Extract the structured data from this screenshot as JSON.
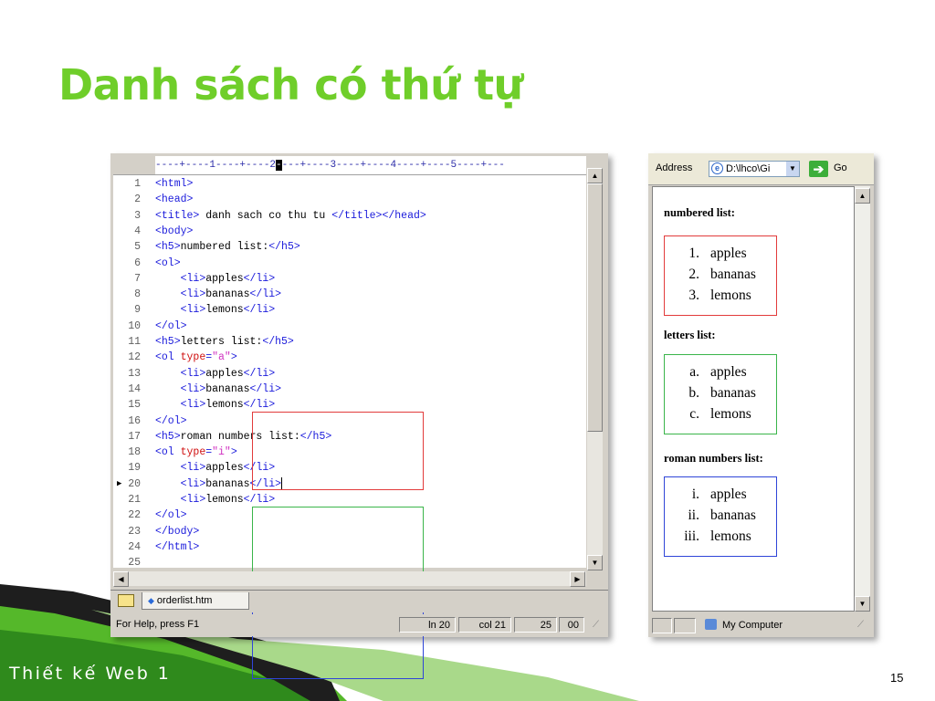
{
  "slide": {
    "title": "Danh sách có thứ tự",
    "footer": "Thiết kế Web 1",
    "page_number": "15"
  },
  "editor": {
    "ruler_text": "----+----1----+----2",
    "ruler_mark": "-",
    "ruler_rest": "---+----3----+----4----+----5----+---",
    "lines": [
      {
        "n": "1",
        "parts": [
          [
            "tag",
            "<html>"
          ]
        ]
      },
      {
        "n": "2",
        "parts": [
          [
            "tag",
            "<head>"
          ]
        ]
      },
      {
        "n": "3",
        "parts": [
          [
            "tag",
            "<title>"
          ],
          [
            "txt",
            " danh sach co thu tu "
          ],
          [
            "tag",
            "</title></head>"
          ]
        ]
      },
      {
        "n": "4",
        "parts": [
          [
            "tag",
            "<body>"
          ]
        ]
      },
      {
        "n": "5",
        "parts": [
          [
            "tag",
            "<h5>"
          ],
          [
            "txt",
            "numbered list:"
          ],
          [
            "tag",
            "</h5>"
          ]
        ]
      },
      {
        "n": "6",
        "parts": [
          [
            "tag",
            "<ol>"
          ]
        ]
      },
      {
        "n": "7",
        "parts": [
          [
            "txt",
            "    "
          ],
          [
            "tag",
            "<li>"
          ],
          [
            "txt",
            "apples"
          ],
          [
            "tag",
            "</li>"
          ]
        ]
      },
      {
        "n": "8",
        "parts": [
          [
            "txt",
            "    "
          ],
          [
            "tag",
            "<li>"
          ],
          [
            "txt",
            "bananas"
          ],
          [
            "tag",
            "</li>"
          ]
        ]
      },
      {
        "n": "9",
        "parts": [
          [
            "txt",
            "    "
          ],
          [
            "tag",
            "<li>"
          ],
          [
            "txt",
            "lemons"
          ],
          [
            "tag",
            "</li>"
          ]
        ]
      },
      {
        "n": "10",
        "parts": [
          [
            "tag",
            "</ol>"
          ]
        ]
      },
      {
        "n": "11",
        "parts": [
          [
            "tag",
            "<h5>"
          ],
          [
            "txt",
            "letters list:"
          ],
          [
            "tag",
            "</h5>"
          ]
        ]
      },
      {
        "n": "12",
        "parts": [
          [
            "tag",
            "<ol "
          ],
          [
            "attr",
            "type"
          ],
          [
            "tag",
            "="
          ],
          [
            "val",
            "\"a\""
          ],
          [
            "tag",
            ">"
          ]
        ]
      },
      {
        "n": "13",
        "parts": [
          [
            "txt",
            "    "
          ],
          [
            "tag",
            "<li>"
          ],
          [
            "txt",
            "apples"
          ],
          [
            "tag",
            "</li>"
          ]
        ]
      },
      {
        "n": "14",
        "parts": [
          [
            "txt",
            "    "
          ],
          [
            "tag",
            "<li>"
          ],
          [
            "txt",
            "bananas"
          ],
          [
            "tag",
            "</li>"
          ]
        ]
      },
      {
        "n": "15",
        "parts": [
          [
            "txt",
            "    "
          ],
          [
            "tag",
            "<li>"
          ],
          [
            "txt",
            "lemons"
          ],
          [
            "tag",
            "</li>"
          ]
        ]
      },
      {
        "n": "16",
        "parts": [
          [
            "tag",
            "</ol>"
          ]
        ]
      },
      {
        "n": "17",
        "parts": [
          [
            "tag",
            "<h5>"
          ],
          [
            "txt",
            "roman numbers list:"
          ],
          [
            "tag",
            "</h5>"
          ]
        ]
      },
      {
        "n": "18",
        "parts": [
          [
            "tag",
            "<ol "
          ],
          [
            "attr",
            "type"
          ],
          [
            "tag",
            "="
          ],
          [
            "val",
            "\"i\""
          ],
          [
            "tag",
            ">"
          ]
        ]
      },
      {
        "n": "19",
        "parts": [
          [
            "txt",
            "    "
          ],
          [
            "tag",
            "<li>"
          ],
          [
            "txt",
            "apples"
          ],
          [
            "tag",
            "</li>"
          ]
        ]
      },
      {
        "n": "20",
        "parts": [
          [
            "txt",
            "    "
          ],
          [
            "tag",
            "<li>"
          ],
          [
            "txt",
            "bananas"
          ],
          [
            "tag",
            "</li>"
          ]
        ]
      },
      {
        "n": "21",
        "parts": [
          [
            "txt",
            "    "
          ],
          [
            "tag",
            "<li>"
          ],
          [
            "txt",
            "lemons"
          ],
          [
            "tag",
            "</li>"
          ]
        ]
      },
      {
        "n": "22",
        "parts": [
          [
            "tag",
            "</ol>"
          ]
        ]
      },
      {
        "n": "23",
        "parts": [
          [
            "tag",
            "</body>"
          ]
        ]
      },
      {
        "n": "24",
        "parts": [
          [
            "tag",
            "</html>"
          ]
        ]
      },
      {
        "n": "25",
        "parts": []
      }
    ],
    "current_line": "20",
    "file_tab": "orderlist.htm",
    "status": {
      "help": "For Help, press F1",
      "line": "ln 20",
      "col": "col 21",
      "num1": "25",
      "num2": "00"
    }
  },
  "browser": {
    "address_label": "Address",
    "address_value": "D:\\lhco\\Gi",
    "go_label": "Go",
    "status_text": "My Computer",
    "sections": [
      {
        "heading": "numbered list:",
        "items": [
          [
            "1.",
            "apples"
          ],
          [
            "2.",
            "bananas"
          ],
          [
            "3.",
            "lemons"
          ]
        ]
      },
      {
        "heading": "letters list:",
        "items": [
          [
            "a.",
            "apples"
          ],
          [
            "b.",
            "bananas"
          ],
          [
            "c.",
            "lemons"
          ]
        ]
      },
      {
        "heading": "roman numbers list:",
        "items": [
          [
            "i.",
            "apples"
          ],
          [
            "ii.",
            "bananas"
          ],
          [
            "iii.",
            "lemons"
          ]
        ]
      }
    ]
  },
  "colors": {
    "title_green": "#6fce2a",
    "box_red": "#e23b3b",
    "box_green": "#3ab54a",
    "box_blue": "#2f45d8",
    "code_tag": "#1a1adb",
    "code_attr": "#d01010",
    "code_value": "#d030c0"
  }
}
